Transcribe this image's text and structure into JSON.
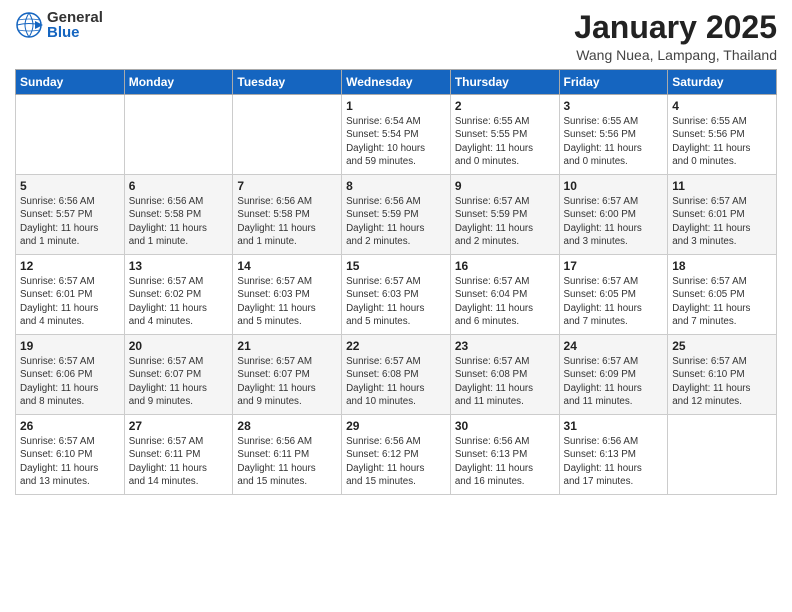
{
  "header": {
    "logo_general": "General",
    "logo_blue": "Blue",
    "month": "January 2025",
    "location": "Wang Nuea, Lampang, Thailand"
  },
  "weekdays": [
    "Sunday",
    "Monday",
    "Tuesday",
    "Wednesday",
    "Thursday",
    "Friday",
    "Saturday"
  ],
  "weeks": [
    [
      {
        "day": "",
        "info": ""
      },
      {
        "day": "",
        "info": ""
      },
      {
        "day": "",
        "info": ""
      },
      {
        "day": "1",
        "info": "Sunrise: 6:54 AM\nSunset: 5:54 PM\nDaylight: 10 hours\nand 59 minutes."
      },
      {
        "day": "2",
        "info": "Sunrise: 6:55 AM\nSunset: 5:55 PM\nDaylight: 11 hours\nand 0 minutes."
      },
      {
        "day": "3",
        "info": "Sunrise: 6:55 AM\nSunset: 5:56 PM\nDaylight: 11 hours\nand 0 minutes."
      },
      {
        "day": "4",
        "info": "Sunrise: 6:55 AM\nSunset: 5:56 PM\nDaylight: 11 hours\nand 0 minutes."
      }
    ],
    [
      {
        "day": "5",
        "info": "Sunrise: 6:56 AM\nSunset: 5:57 PM\nDaylight: 11 hours\nand 1 minute."
      },
      {
        "day": "6",
        "info": "Sunrise: 6:56 AM\nSunset: 5:58 PM\nDaylight: 11 hours\nand 1 minute."
      },
      {
        "day": "7",
        "info": "Sunrise: 6:56 AM\nSunset: 5:58 PM\nDaylight: 11 hours\nand 1 minute."
      },
      {
        "day": "8",
        "info": "Sunrise: 6:56 AM\nSunset: 5:59 PM\nDaylight: 11 hours\nand 2 minutes."
      },
      {
        "day": "9",
        "info": "Sunrise: 6:57 AM\nSunset: 5:59 PM\nDaylight: 11 hours\nand 2 minutes."
      },
      {
        "day": "10",
        "info": "Sunrise: 6:57 AM\nSunset: 6:00 PM\nDaylight: 11 hours\nand 3 minutes."
      },
      {
        "day": "11",
        "info": "Sunrise: 6:57 AM\nSunset: 6:01 PM\nDaylight: 11 hours\nand 3 minutes."
      }
    ],
    [
      {
        "day": "12",
        "info": "Sunrise: 6:57 AM\nSunset: 6:01 PM\nDaylight: 11 hours\nand 4 minutes."
      },
      {
        "day": "13",
        "info": "Sunrise: 6:57 AM\nSunset: 6:02 PM\nDaylight: 11 hours\nand 4 minutes."
      },
      {
        "day": "14",
        "info": "Sunrise: 6:57 AM\nSunset: 6:03 PM\nDaylight: 11 hours\nand 5 minutes."
      },
      {
        "day": "15",
        "info": "Sunrise: 6:57 AM\nSunset: 6:03 PM\nDaylight: 11 hours\nand 5 minutes."
      },
      {
        "day": "16",
        "info": "Sunrise: 6:57 AM\nSunset: 6:04 PM\nDaylight: 11 hours\nand 6 minutes."
      },
      {
        "day": "17",
        "info": "Sunrise: 6:57 AM\nSunset: 6:05 PM\nDaylight: 11 hours\nand 7 minutes."
      },
      {
        "day": "18",
        "info": "Sunrise: 6:57 AM\nSunset: 6:05 PM\nDaylight: 11 hours\nand 7 minutes."
      }
    ],
    [
      {
        "day": "19",
        "info": "Sunrise: 6:57 AM\nSunset: 6:06 PM\nDaylight: 11 hours\nand 8 minutes."
      },
      {
        "day": "20",
        "info": "Sunrise: 6:57 AM\nSunset: 6:07 PM\nDaylight: 11 hours\nand 9 minutes."
      },
      {
        "day": "21",
        "info": "Sunrise: 6:57 AM\nSunset: 6:07 PM\nDaylight: 11 hours\nand 9 minutes."
      },
      {
        "day": "22",
        "info": "Sunrise: 6:57 AM\nSunset: 6:08 PM\nDaylight: 11 hours\nand 10 minutes."
      },
      {
        "day": "23",
        "info": "Sunrise: 6:57 AM\nSunset: 6:08 PM\nDaylight: 11 hours\nand 11 minutes."
      },
      {
        "day": "24",
        "info": "Sunrise: 6:57 AM\nSunset: 6:09 PM\nDaylight: 11 hours\nand 11 minutes."
      },
      {
        "day": "25",
        "info": "Sunrise: 6:57 AM\nSunset: 6:10 PM\nDaylight: 11 hours\nand 12 minutes."
      }
    ],
    [
      {
        "day": "26",
        "info": "Sunrise: 6:57 AM\nSunset: 6:10 PM\nDaylight: 11 hours\nand 13 minutes."
      },
      {
        "day": "27",
        "info": "Sunrise: 6:57 AM\nSunset: 6:11 PM\nDaylight: 11 hours\nand 14 minutes."
      },
      {
        "day": "28",
        "info": "Sunrise: 6:56 AM\nSunset: 6:11 PM\nDaylight: 11 hours\nand 15 minutes."
      },
      {
        "day": "29",
        "info": "Sunrise: 6:56 AM\nSunset: 6:12 PM\nDaylight: 11 hours\nand 15 minutes."
      },
      {
        "day": "30",
        "info": "Sunrise: 6:56 AM\nSunset: 6:13 PM\nDaylight: 11 hours\nand 16 minutes."
      },
      {
        "day": "31",
        "info": "Sunrise: 6:56 AM\nSunset: 6:13 PM\nDaylight: 11 hours\nand 17 minutes."
      },
      {
        "day": "",
        "info": ""
      }
    ]
  ]
}
